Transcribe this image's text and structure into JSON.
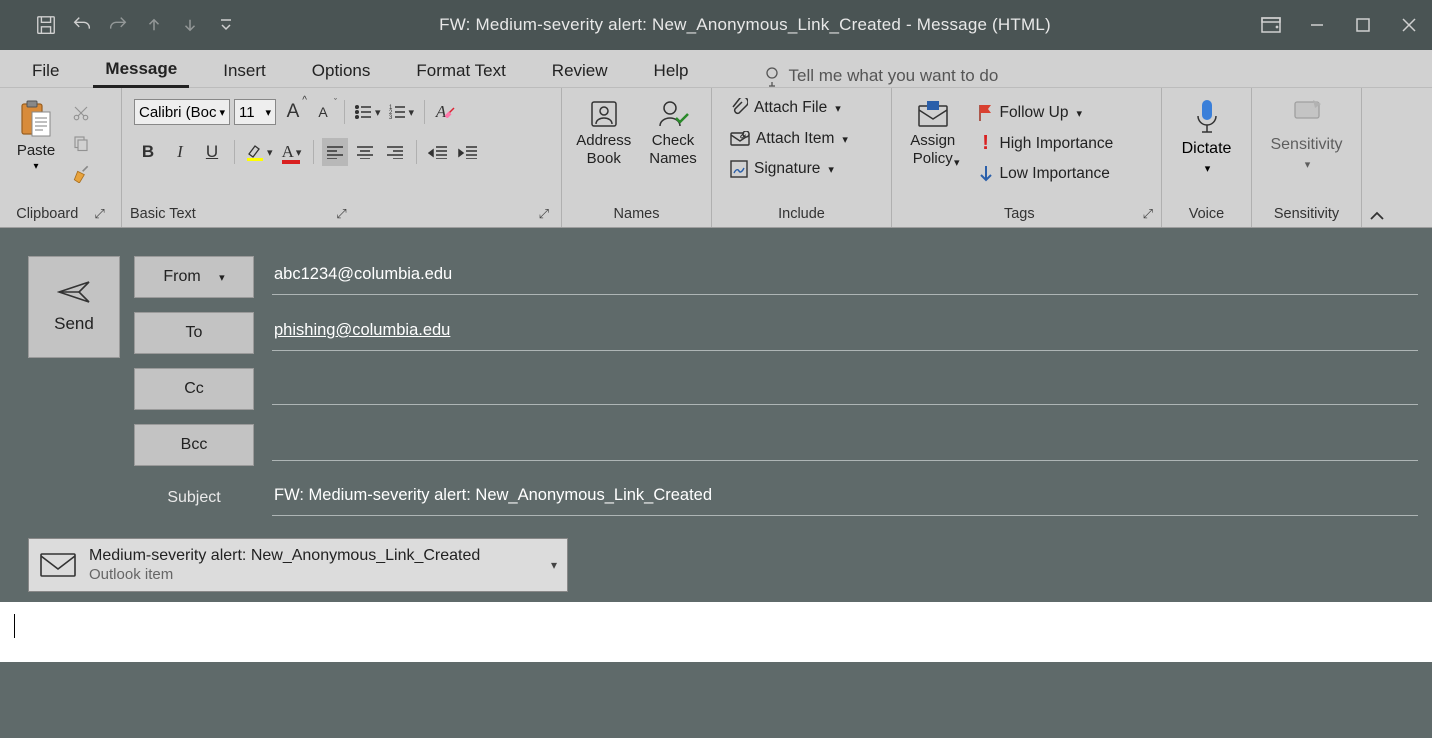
{
  "window": {
    "title": "FW: Medium-severity alert: New_Anonymous_Link_Created  -  Message (HTML)"
  },
  "tabs": {
    "file": "File",
    "message": "Message",
    "insert": "Insert",
    "options": "Options",
    "format": "Format Text",
    "review": "Review",
    "help": "Help",
    "tellme": "Tell me what you want to do"
  },
  "ribbon": {
    "clipboard": {
      "label": "Clipboard",
      "paste": "Paste"
    },
    "basicText": {
      "label": "Basic Text",
      "font": "Calibri (Boc",
      "size": "11"
    },
    "names": {
      "label": "Names",
      "address": "Address\nBook",
      "check": "Check\nNames"
    },
    "include": {
      "label": "Include",
      "attachFile": "Attach File",
      "attachItem": "Attach Item",
      "signature": "Signature"
    },
    "tags": {
      "label": "Tags",
      "assign": "Assign\nPolicy",
      "follow": "Follow Up",
      "high": "High Importance",
      "low": "Low Importance"
    },
    "voice": {
      "label": "Voice",
      "dictate": "Dictate"
    },
    "sensitivity": {
      "label": "Sensitivity",
      "btn": "Sensitivity"
    }
  },
  "compose": {
    "send": "Send",
    "from": "From",
    "fromValue": "abc1234@columbia.edu",
    "to": "To",
    "toValue": "phishing@columbia.edu",
    "cc": "Cc",
    "ccValue": "",
    "bcc": "Bcc",
    "bccValue": "",
    "subject": "Subject",
    "subjectValue": "FW: Medium-severity alert: New_Anonymous_Link_Created"
  },
  "attachment": {
    "title": "Medium-severity alert: New_Anonymous_Link_Created",
    "subtitle": "Outlook item"
  }
}
